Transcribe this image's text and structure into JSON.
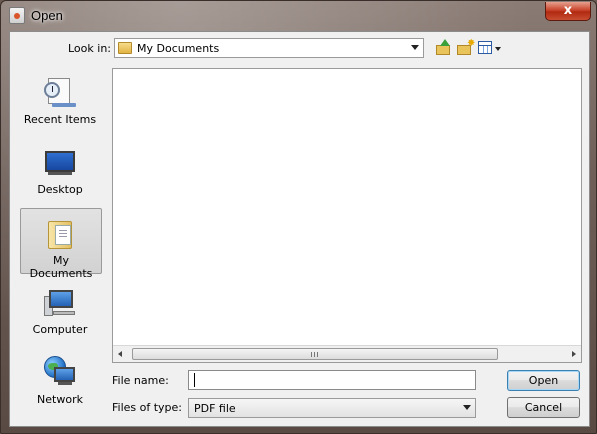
{
  "window": {
    "title": "Open",
    "close_label": "x"
  },
  "toolbar": {
    "look_in_label": "Look in:",
    "look_in_value": "My Documents",
    "icons": [
      "up-one-level-icon",
      "create-new-folder-icon",
      "view-menu-icon"
    ]
  },
  "places": [
    {
      "label": "Recent Items",
      "icon": "recent-items-icon",
      "selected": false
    },
    {
      "label": "Desktop",
      "icon": "desktop-icon",
      "selected": false
    },
    {
      "label": "My Documents",
      "icon": "my-documents-icon",
      "selected": true
    },
    {
      "label": "Computer",
      "icon": "computer-icon",
      "selected": false
    },
    {
      "label": "Network",
      "icon": "network-icon",
      "selected": false
    }
  ],
  "file_list": {
    "items": [],
    "scroll_grip": "III"
  },
  "form": {
    "file_name_label": "File name:",
    "file_name_value": "",
    "files_of_type_label": "Files of type:",
    "files_of_type_value": "PDF file"
  },
  "buttons": {
    "open_label": "Open",
    "cancel_label": "Cancel"
  }
}
